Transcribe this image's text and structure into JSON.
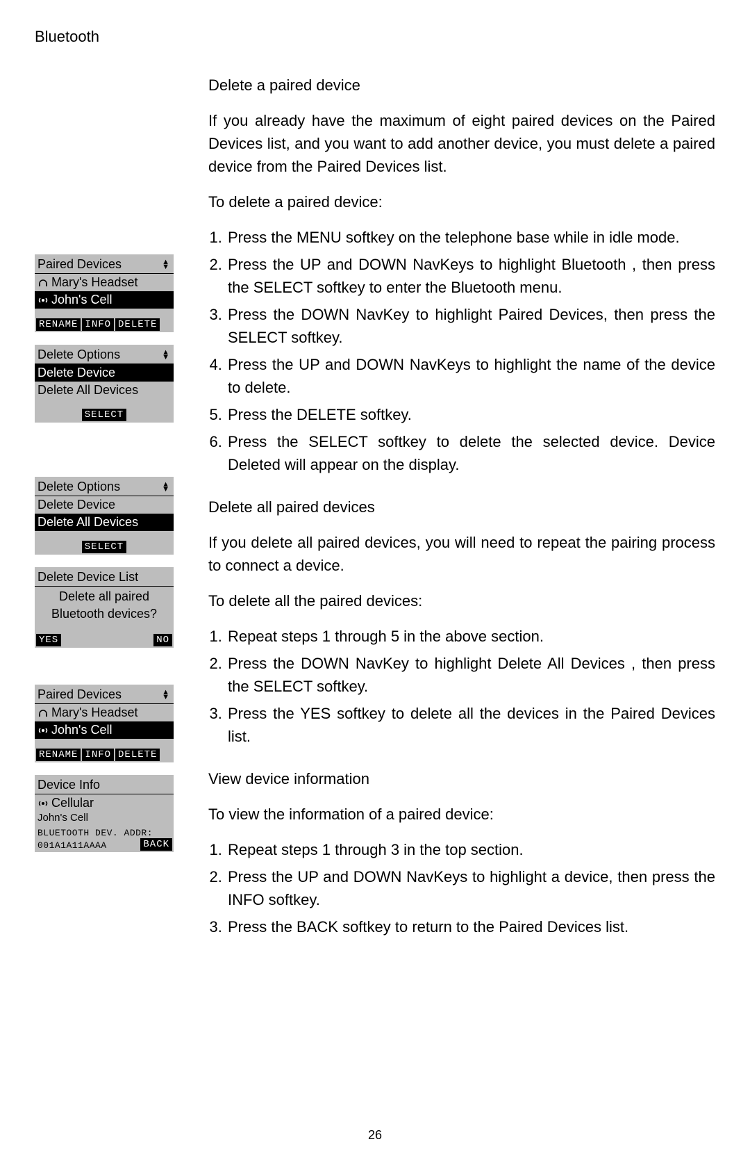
{
  "header": "Bluetooth",
  "page_number": "26",
  "section1": {
    "title": "Delete a paired device",
    "intro": "If you already have the maximum of eight paired devices on the Paired Devices list, and you want to add another device, you must delete a paired device from the Paired Devices list.",
    "lead": "To delete a paired device:",
    "steps": [
      "Press the MENU softkey on the telephone base while in idle mode.",
      "Press the UP and DOWN NavKeys to highlight Bluetooth , then press the SELECT softkey to enter the Bluetooth  menu.",
      "Press the DOWN NavKey to highlight Paired Devices, then press the SELECT softkey.",
      "Press the UP and DOWN NavKeys to highlight the name of the device to delete.",
      "Press the DELETE softkey.",
      "Press the SELECT softkey to delete the selected device. Device Deleted  will appear on the display."
    ]
  },
  "section2": {
    "title": "Delete all paired devices",
    "intro": "If you delete all paired devices, you will need to repeat the pairing process to connect a device.",
    "lead": "To delete all the paired devices:",
    "steps": [
      "Repeat steps 1 through 5 in the above section.",
      "Press the DOWN NavKey to highlight Delete All Devices , then press the SELECT softkey.",
      "Press the YES softkey to delete all the devices in the Paired Devices list."
    ]
  },
  "section3": {
    "title": "View device information",
    "lead": "To view the information of a paired device:",
    "steps": [
      "Repeat steps 1 through 3 in the top section.",
      "Press the UP and DOWN NavKeys to highlight a device, then press the INFO softkey.",
      "Press the BACK softkey to return to the Paired Devices list."
    ]
  },
  "lcd1": {
    "title": "Paired Devices",
    "item1": "Mary's Headset",
    "item2": "John's Cell",
    "sk1": "RENAME",
    "sk2": "INFO",
    "sk3": "DELETE"
  },
  "lcd2": {
    "title": "Delete Options",
    "item1": "Delete Device",
    "item2": "Delete All Devices",
    "sk": "SELECT"
  },
  "lcd3": {
    "title": "Delete Options",
    "item1": "Delete Device",
    "item2": "Delete All Devices",
    "sk": "SELECT"
  },
  "lcd4": {
    "title": "Delete Device List",
    "msg1": "Delete all paired",
    "msg2": "Bluetooth devices?",
    "sk1": "YES",
    "sk2": "NO"
  },
  "lcd5": {
    "title": "Paired Devices",
    "item1": "Mary's Headset",
    "item2": "John's Cell",
    "sk1": "RENAME",
    "sk2": "INFO",
    "sk3": "DELETE"
  },
  "lcd6": {
    "title": "Device Info",
    "type": "Cellular",
    "name": "John's Cell",
    "addr_label": "BLUETOOTH DEV. ADDR:",
    "addr": "001A1A11AAAA",
    "sk": "BACK"
  }
}
